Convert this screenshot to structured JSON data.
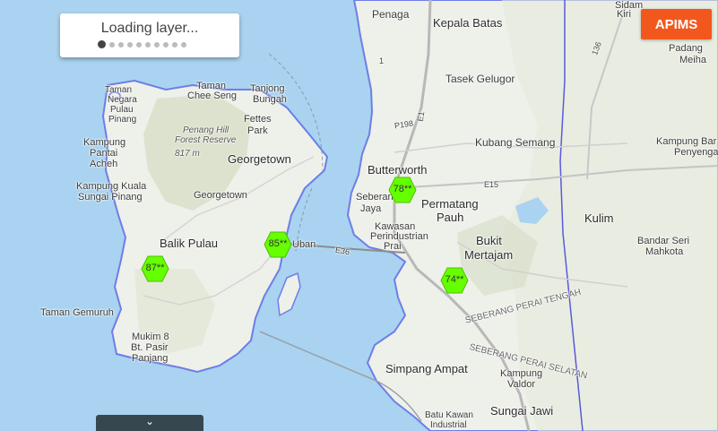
{
  "loading": {
    "text": "Loading layer...",
    "dots": 10,
    "active_dot": 0
  },
  "apims_button": {
    "label": "APIMS",
    "color": "#f2581d"
  },
  "aqi_markers": [
    {
      "value": "87**",
      "color": "#66ff00"
    },
    {
      "value": "85**",
      "color": "#66ff00"
    },
    {
      "value": "78**",
      "color": "#66ff00"
    },
    {
      "value": "74**",
      "color": "#66ff00"
    }
  ],
  "places": {
    "penaga": "Penaga",
    "kepala_batas": "Kepala Batas",
    "tasek_gelugor": "Tasek Gelugor",
    "kubang_semang": "Kubang Semang",
    "butterworth": "Butterworth",
    "seberang_jaya_1": "Seberang",
    "seberang_jaya_2": "Jaya",
    "permatang_pauh_1": "Permatang",
    "permatang_pauh_2": "Pauh",
    "kawasan_1": "Kawasan",
    "kawasan_2": "Perindustrian",
    "kawasan_3": "Prai",
    "bukit_1": "Bukit",
    "bukit_2": "Mertajam",
    "kulim": "Kulim",
    "bandar_1": "Bandar Seri",
    "bandar_2": "Mahkota",
    "kampung_bar_1": "Kampung Bar",
    "kampung_bar_2": "Penyenga",
    "sidam_1": "Sidam",
    "sidam_2": "Kiri",
    "padang_1": "Padang",
    "padang_2": "Meiha",
    "taman_negara_1": "Taman",
    "taman_negara_2": "Negara",
    "taman_negara_3": "Pulau",
    "taman_negara_4": "Pinang",
    "tanjong_1": "Tanjong",
    "tanjong_2": "Bungah",
    "taman_chee_1": "Taman",
    "taman_chee_2": "Chee Seng",
    "fettes_1": "Fettes",
    "fettes_2": "Park",
    "penang_hill_1": "Penang Hill",
    "penang_hill_2": "Forest Reserve",
    "penang_hill_3": "817 m",
    "georgetown_city": "Georgetown",
    "georgetown_small": "Georgetown",
    "kampung_pantai_1": "Kampung",
    "kampung_pantai_2": "Pantai",
    "kampung_pantai_3": "Acheh",
    "kampung_kuala_1": "Kampung Kuala",
    "kampung_kuala_2": "Sungai Pinang",
    "balik_pulau": "Balik Pulau",
    "taman_gemuruh": "Taman Gemuruh",
    "mukim_1": "Mukim 8",
    "mukim_2": "Bt. Pasir",
    "mukim_3": "Panjang",
    "uban": "Uban",
    "simpang_ampat": "Simpang Ampat",
    "kampung_valdor_1": "Kampung",
    "kampung_valdor_2": "Valdor",
    "sungai_jawi": "Sungai Jawi",
    "batu_kawan_1": "Batu Kawan",
    "batu_kawan_2": "Industrial",
    "seberang_tengah": "SEBERANG PERAI TENGAH",
    "seberang_selatan": "SEBERANG PERAI SELATAN",
    "road_e1": "E1",
    "road_p198": "P198",
    "road_e15": "E15",
    "road_e36": "E36",
    "road_136": "136",
    "road_1": "1"
  }
}
